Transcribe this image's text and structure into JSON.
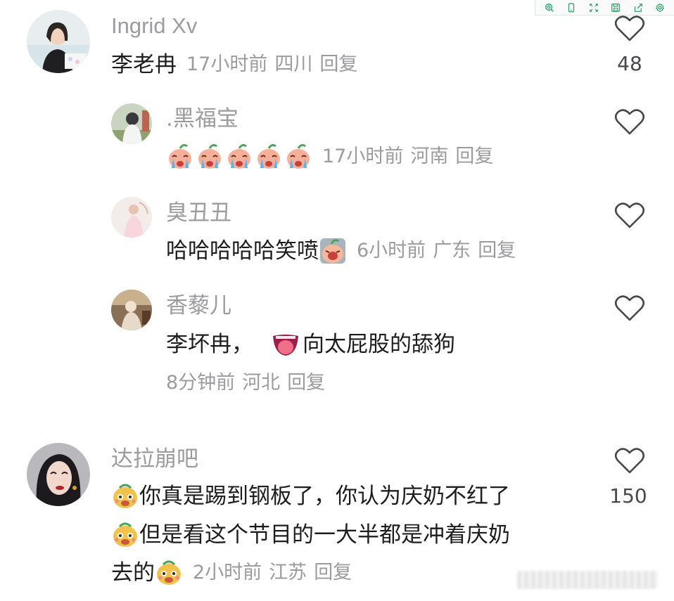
{
  "toolbar": {
    "icons": [
      "search-icon",
      "phone-icon",
      "fullscreen-icon",
      "save-icon",
      "share-icon",
      "gear-icon"
    ],
    "accent": "#2ea66b"
  },
  "comments": [
    {
      "username": "Ingrid Xv",
      "text": "李老冉",
      "time": "17小时前",
      "location": "四川",
      "reply": "回复",
      "likes": "48"
    },
    {
      "username": ".黑福宝",
      "emoji_count": 5,
      "emoji": "crying-peach-emoji",
      "time": "17小时前",
      "location": "河南",
      "reply": "回复"
    },
    {
      "username": "臭丑丑",
      "text": "哈哈哈哈哈笑喷",
      "emoji": "laughing-peach-emoji",
      "time": "6小时前",
      "location": "广东",
      "reply": "回复"
    },
    {
      "username": "香藜儿",
      "text_before": "李坏冉，",
      "emoji": "tongue-mouth-emoji",
      "text_after": "向太屁股的舔狗",
      "time": "8分钟前",
      "location": "河北",
      "reply": "回复"
    },
    {
      "username": "达拉崩吧",
      "line1": "你真是踢到钢板了，你认为庆奶不红了",
      "line2": "但是看这个节目的一大半都是冲着庆奶",
      "line3": "去的",
      "emoji": "dog-face-emoji",
      "time": "2小时前",
      "location": "江苏",
      "reply": "回复",
      "likes": "150"
    }
  ],
  "colors": {
    "username": "#9b9ba0",
    "text": "#1d1d1f",
    "meta": "#9b9ba0"
  }
}
